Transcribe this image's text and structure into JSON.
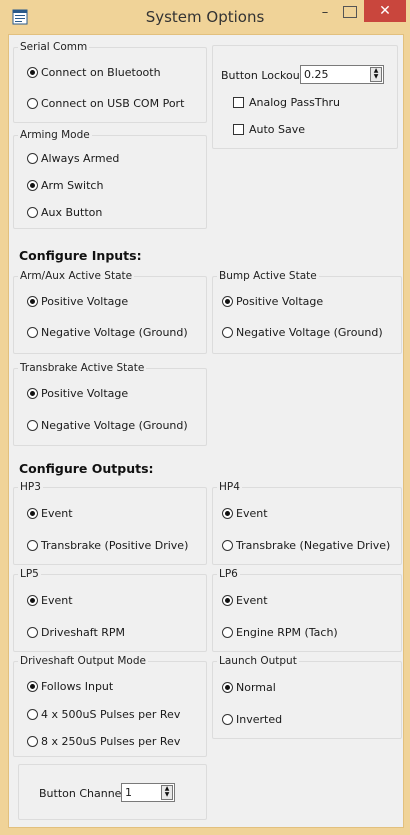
{
  "window": {
    "title": "System Options",
    "min_glyph": "–",
    "close_glyph": "✕"
  },
  "serial_comm": {
    "legend": "Serial Comm",
    "options": [
      {
        "label": "Connect on Bluetooth",
        "selected": true
      },
      {
        "label": "Connect on USB COM Port",
        "selected": false
      }
    ]
  },
  "button_lockout": {
    "label": "Button Lockout",
    "value": "0.25"
  },
  "analog_passthru": {
    "label": "Analog PassThru",
    "checked": false
  },
  "auto_save": {
    "label": "Auto Save",
    "checked": false
  },
  "arming_mode": {
    "legend": "Arming Mode",
    "options": [
      {
        "label": "Always Armed",
        "selected": false
      },
      {
        "label": "Arm Switch",
        "selected": true
      },
      {
        "label": "Aux Button",
        "selected": false
      }
    ]
  },
  "configure_inputs": {
    "heading": "Configure Inputs:"
  },
  "arm_aux_active": {
    "legend": "Arm/Aux Active State",
    "options": [
      {
        "label": "Positive Voltage",
        "selected": true
      },
      {
        "label": "Negative Voltage (Ground)",
        "selected": false
      }
    ]
  },
  "bump_active": {
    "legend": "Bump Active State",
    "options": [
      {
        "label": "Positive Voltage",
        "selected": true
      },
      {
        "label": "Negative Voltage (Ground)",
        "selected": false
      }
    ]
  },
  "transbrake_active": {
    "legend": "Transbrake Active State",
    "options": [
      {
        "label": "Positive Voltage",
        "selected": true
      },
      {
        "label": "Negative Voltage (Ground)",
        "selected": false
      }
    ]
  },
  "configure_outputs": {
    "heading": "Configure Outputs:"
  },
  "hp3": {
    "legend": "HP3",
    "options": [
      {
        "label": "Event",
        "selected": true
      },
      {
        "label": "Transbrake (Positive Drive)",
        "selected": false
      }
    ]
  },
  "hp4": {
    "legend": "HP4",
    "options": [
      {
        "label": "Event",
        "selected": true
      },
      {
        "label": "Transbrake (Negative Drive)",
        "selected": false
      }
    ]
  },
  "lp5": {
    "legend": "LP5",
    "options": [
      {
        "label": "Event",
        "selected": true
      },
      {
        "label": "Driveshaft RPM",
        "selected": false
      }
    ]
  },
  "lp6": {
    "legend": "LP6",
    "options": [
      {
        "label": "Event",
        "selected": true
      },
      {
        "label": "Engine RPM (Tach)",
        "selected": false
      }
    ]
  },
  "driveshaft_output_mode": {
    "legend": "Driveshaft Output Mode",
    "options": [
      {
        "label": "Follows Input",
        "selected": true
      },
      {
        "label": "4 x 500uS Pulses per Rev",
        "selected": false
      },
      {
        "label": "8 x 250uS Pulses per Rev",
        "selected": false
      }
    ]
  },
  "launch_output": {
    "legend": "Launch Output",
    "options": [
      {
        "label": "Normal",
        "selected": true
      },
      {
        "label": "Inverted",
        "selected": false
      }
    ]
  },
  "button_channel": {
    "label": "Button Channel",
    "value": "1"
  },
  "spinner": {
    "up_glyph": "▲",
    "down_glyph": "▼"
  }
}
